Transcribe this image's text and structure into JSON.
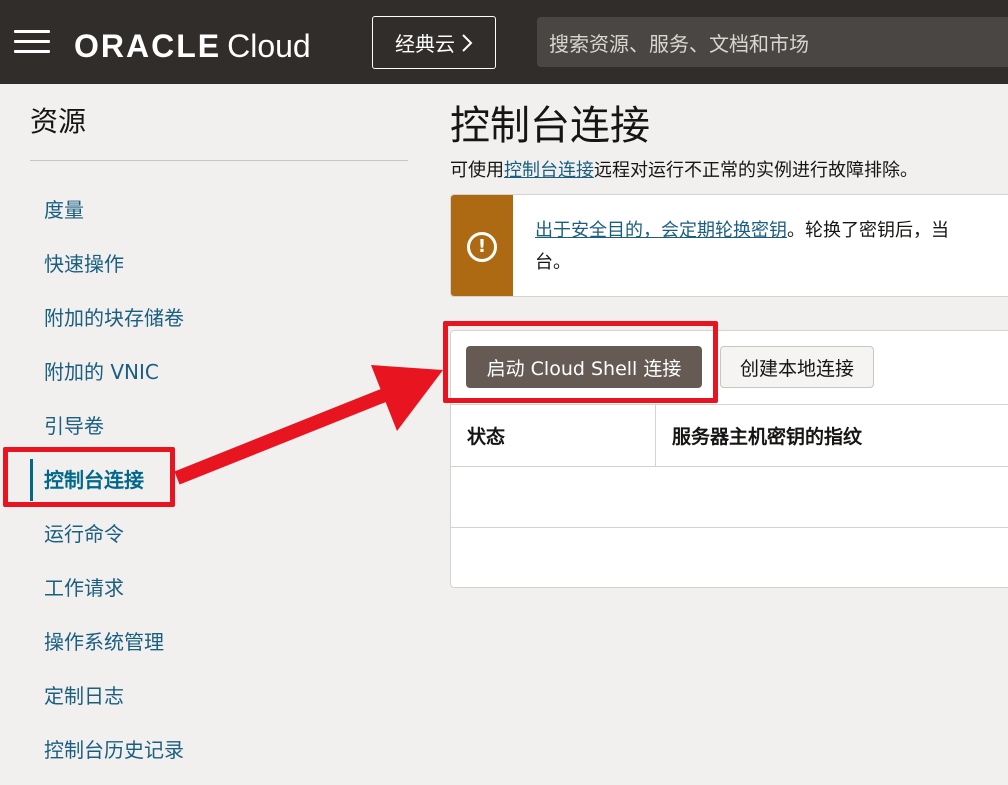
{
  "header": {
    "brand": "ORACLE",
    "brand_suffix": "Cloud",
    "classic_button": "经典云",
    "search_placeholder": "搜索资源、服务、文档和市场"
  },
  "sidebar": {
    "title": "资源",
    "items": [
      {
        "label": "度量"
      },
      {
        "label": "快速操作"
      },
      {
        "label": "附加的块存储卷"
      },
      {
        "label": "附加的 VNIC"
      },
      {
        "label": "引导卷"
      },
      {
        "label": "控制台连接",
        "active": true
      },
      {
        "label": "运行命令"
      },
      {
        "label": "工作请求"
      },
      {
        "label": "操作系统管理"
      },
      {
        "label": "定制日志"
      },
      {
        "label": "控制台历史记录"
      }
    ]
  },
  "main": {
    "title": "控制台连接",
    "description_prefix": "可使用",
    "description_link": "控制台连接",
    "description_suffix": "远程对运行不正常的实例进行故障排除。",
    "notice": {
      "link": "出于安全目的，会定期轮换密钥",
      "text": "。轮换了密钥后，当",
      "text_wrap": "台。"
    },
    "buttons": {
      "cloud_shell": "启动 Cloud Shell 连接",
      "local": "创建本地连接"
    },
    "table": {
      "headers": [
        "状态",
        "服务器主机密钥的指纹"
      ]
    }
  },
  "colors": {
    "header_bg": "#312d2a",
    "link": "#1a5e80",
    "warning": "#ad6a13",
    "primary_button": "#665b54",
    "annotation": "#e8141f"
  }
}
